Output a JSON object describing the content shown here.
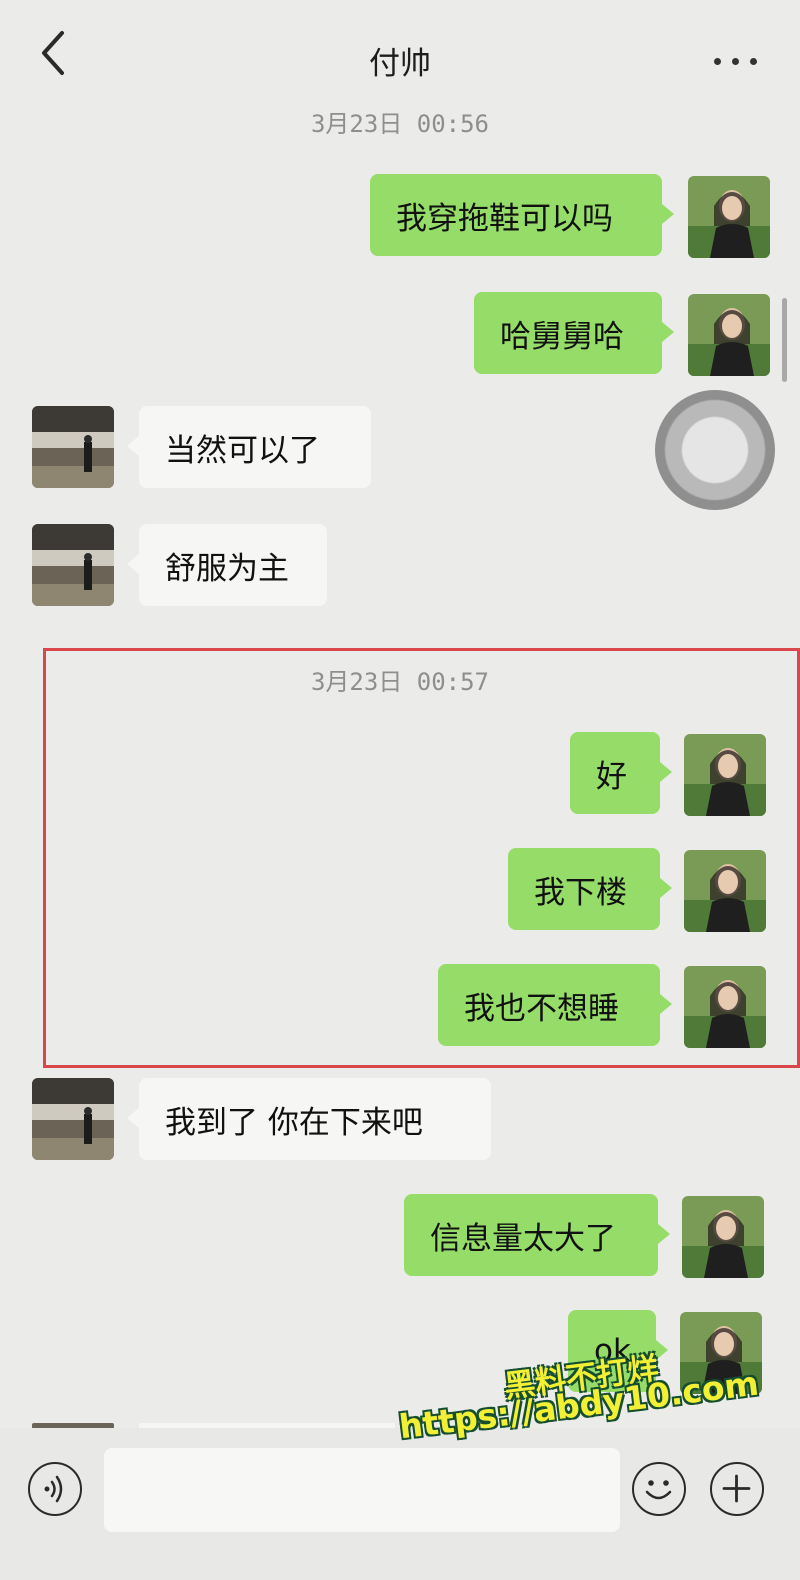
{
  "header": {
    "title": "付帅"
  },
  "timestamps": [
    "3月23日 00:56",
    "3月23日 00:57"
  ],
  "messages": [
    {
      "side": "right",
      "text": "我穿拖鞋可以吗"
    },
    {
      "side": "right",
      "text": "哈舅舅哈"
    },
    {
      "side": "left",
      "text": "当然可以了"
    },
    {
      "side": "left",
      "text": "舒服为主"
    },
    {
      "side": "right",
      "text": "好"
    },
    {
      "side": "right",
      "text": "我下楼"
    },
    {
      "side": "right",
      "text": "我也不想睡"
    },
    {
      "side": "left",
      "text": "我到了 你在下来吧"
    },
    {
      "side": "right",
      "text": "信息量太大了"
    },
    {
      "side": "right",
      "text": "ok"
    }
  ],
  "watermark": {
    "line1": "黑料不打烊",
    "line2": "https://abdy10.com"
  },
  "colors": {
    "accent": "#95dc69",
    "highlight_border": "#d9474d",
    "watermark": "#f2ef35"
  },
  "icons": [
    "back-arrow-icon",
    "more-dots-icon",
    "voice-icon",
    "emoji-icon",
    "plus-icon"
  ]
}
